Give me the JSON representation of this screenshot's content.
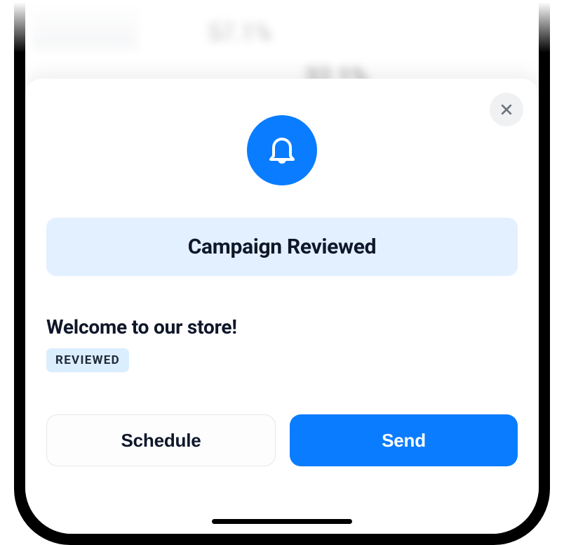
{
  "background": {
    "percent_1": "57.1%",
    "percent_2": "32.1%"
  },
  "modal": {
    "title": "Campaign Reviewed",
    "campaign_name": "Welcome to our store!",
    "status_badge": "REVIEWED",
    "schedule_label": "Schedule",
    "send_label": "Send"
  }
}
